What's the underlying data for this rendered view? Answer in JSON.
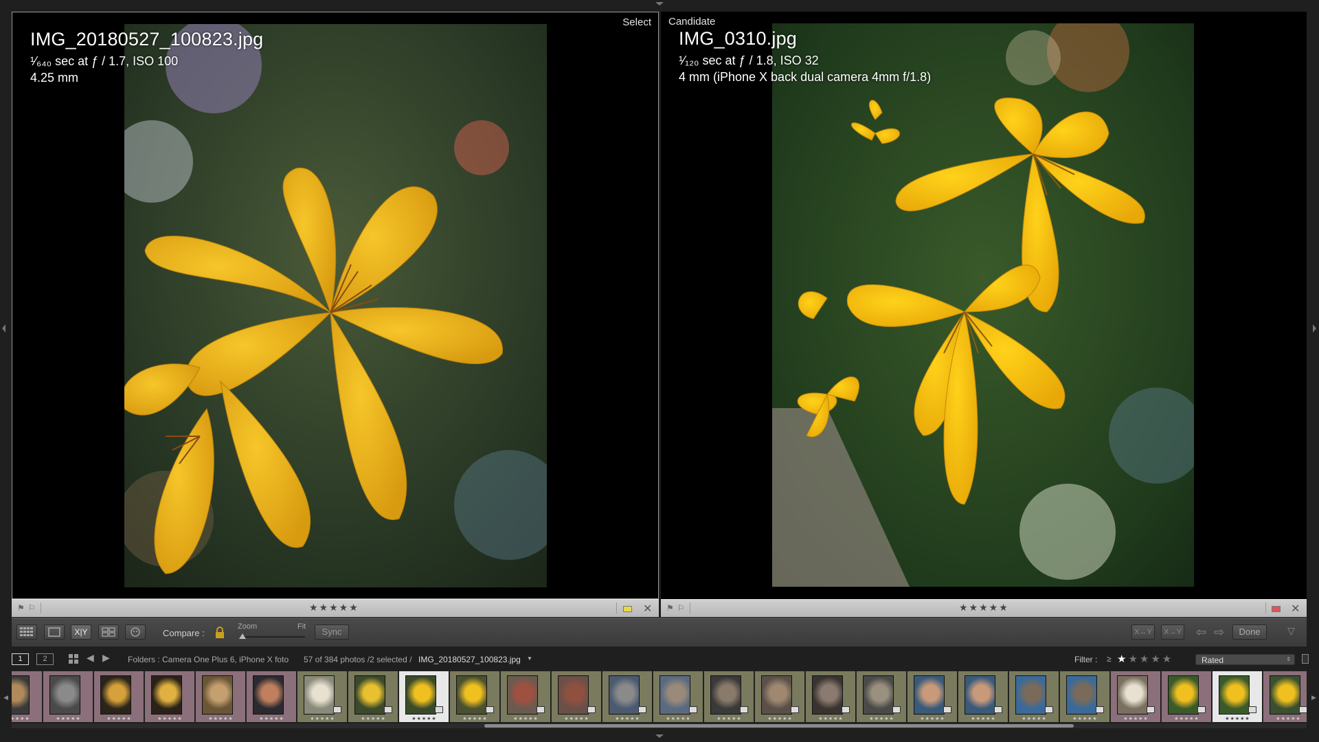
{
  "left_pane": {
    "label": "Select",
    "filename": "IMG_20180527_100823.jpg",
    "exposure": "¹⁄₆₄₀ sec at ƒ / 1.7, ISO 100",
    "focal_length": "4.25 mm",
    "rating_stars": "★★★★★",
    "color_label": "#e8d84a"
  },
  "right_pane": {
    "label": "Candidate",
    "filename": "IMG_0310.jpg",
    "exposure": "¹⁄₁₂₀ sec at ƒ / 1.8, ISO 32",
    "focal_length": "4 mm (iPhone X back dual camera 4mm f/1.8)",
    "rating_stars": "★★★★★",
    "color_label": "#e0555a"
  },
  "toolbar": {
    "compare_label": "Compare :",
    "zoom_label": "Zoom",
    "fit_label": "Fit",
    "sync_label": "Sync",
    "swap_label": "X↔Y",
    "make_select_label": "X→Y",
    "done_label": "Done",
    "grid_icon": "grid-icon",
    "loupe_icon": "loupe-icon",
    "compare_icon": "compare-xy-icon",
    "survey_icon": "survey-icon",
    "people_icon": "people-icon",
    "lock_icon": "lock-icon"
  },
  "filmstrip_header": {
    "view1": "1",
    "view2": "2",
    "breadcrumb": "Folders : Camera One Plus 6, iPhone X foto",
    "count": "57 of 384 photos /2 selected /",
    "current_file": "IMG_20180527_100823.jpg",
    "filter_label": "Filter :",
    "filter_op": "≥",
    "filter_stars": "★★★★★",
    "filter_value": "Rated"
  },
  "filmstrip": {
    "cell_stars": "★★★★★",
    "cells": [
      {
        "bg": "#8b6f7a",
        "thumb": "#3a3a3a",
        "accent": "#b08a5a"
      },
      {
        "bg": "#8b6f7a",
        "thumb": "#4a4a4a",
        "accent": "#8a8a8a"
      },
      {
        "bg": "#8b6f7a",
        "thumb": "#2b241a",
        "accent": "#d6a13a"
      },
      {
        "bg": "#8b6f7a",
        "thumb": "#2a2218",
        "accent": "#e0b040"
      },
      {
        "bg": "#8b6f7a",
        "thumb": "#6a5536",
        "accent": "#c4a070"
      },
      {
        "bg": "#8b6f7a",
        "thumb": "#2a2a30",
        "accent": "#c08060"
      },
      {
        "bg": "#7a7a5e",
        "thumb": "#8a8a7a",
        "accent": "#e8e0d0"
      },
      {
        "bg": "#7a7a5e",
        "thumb": "#3a4a2a",
        "accent": "#e8c030"
      },
      {
        "bg": "#e8e8e8",
        "thumb": "#3a4a2a",
        "accent": "#f0c020"
      },
      {
        "bg": "#7a7a5e",
        "thumb": "#4a5030",
        "accent": "#f0c020"
      },
      {
        "bg": "#7a7a5e",
        "thumb": "#6a5a50",
        "accent": "#a05040"
      },
      {
        "bg": "#7a7a5e",
        "thumb": "#6a5048",
        "accent": "#905040"
      },
      {
        "bg": "#7a7a5e",
        "thumb": "#4a5a70",
        "accent": "#8a8a8a"
      },
      {
        "bg": "#7a7a5e",
        "thumb": "#5a6a80",
        "accent": "#9a8a7a"
      },
      {
        "bg": "#7a7a5e",
        "thumb": "#3a3a3a",
        "accent": "#8a7a6a"
      },
      {
        "bg": "#7a7a5e",
        "thumb": "#5a5048",
        "accent": "#a08870"
      },
      {
        "bg": "#7a7a5e",
        "thumb": "#3a3430",
        "accent": "#8a7a70"
      },
      {
        "bg": "#7a7a5e",
        "thumb": "#4a4a48",
        "accent": "#9a9080"
      },
      {
        "bg": "#7a7a5e",
        "thumb": "#3a5a7a",
        "accent": "#c89a7a"
      },
      {
        "bg": "#7a7a5e",
        "thumb": "#3a5a7a",
        "accent": "#c89a7a"
      },
      {
        "bg": "#7a7a5e",
        "thumb": "#3a6a9a",
        "accent": "#7a6a5a"
      },
      {
        "bg": "#7a7a5e",
        "thumb": "#3a6a9a",
        "accent": "#7a6a5a"
      },
      {
        "bg": "#8b6f7a",
        "thumb": "#7a7060",
        "accent": "#e8e0d0"
      },
      {
        "bg": "#8b6f7a",
        "thumb": "#3a5a2a",
        "accent": "#f0c020"
      },
      {
        "bg": "#e8e8e8",
        "thumb": "#3a5a2a",
        "accent": "#f0c020"
      },
      {
        "bg": "#8b6f7a",
        "thumb": "#3a5030",
        "accent": "#f0c020"
      }
    ]
  }
}
